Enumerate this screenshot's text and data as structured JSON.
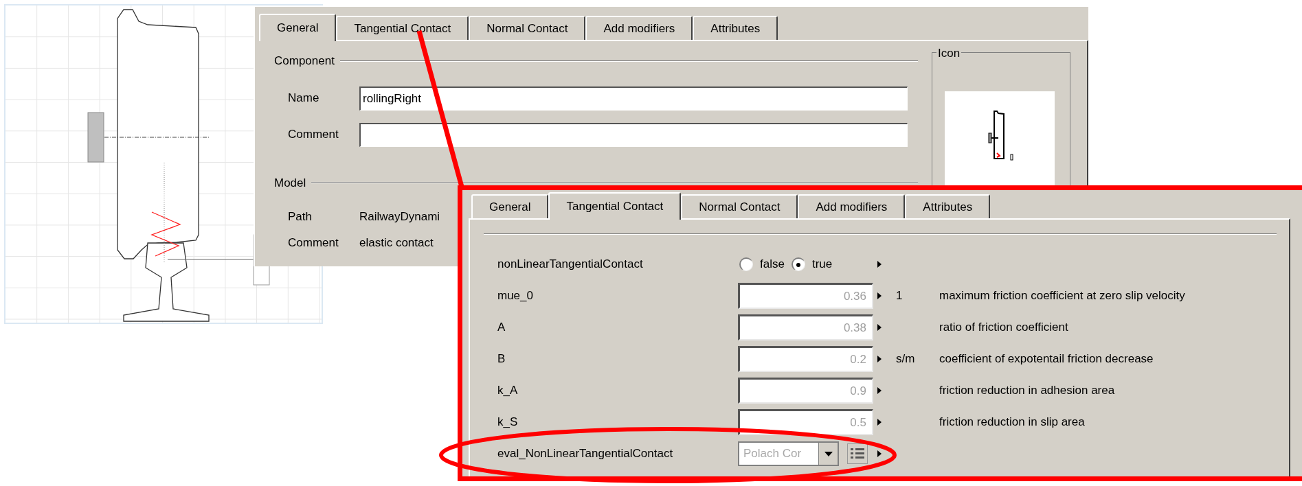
{
  "general_dialog": {
    "tabs": [
      {
        "label": "General",
        "selected": true
      },
      {
        "label": "Tangential Contact",
        "selected": false
      },
      {
        "label": "Normal Contact",
        "selected": false
      },
      {
        "label": "Add modifiers",
        "selected": false
      },
      {
        "label": "Attributes",
        "selected": false
      }
    ],
    "component": {
      "title": "Component",
      "fields": [
        {
          "label": "Name",
          "value": "rollingRight"
        },
        {
          "label": "Comment"
        }
      ]
    },
    "model": {
      "title": "Model",
      "rows": [
        {
          "label": "Path",
          "value": "RailwayDynami"
        },
        {
          "label": "Comment",
          "value": "elastic contact"
        }
      ]
    },
    "icon_group": {
      "title": "Icon"
    }
  },
  "tangential_dialog": {
    "tabs": [
      {
        "label": "General",
        "selected": false
      },
      {
        "label": "Tangential Contact",
        "selected": true
      },
      {
        "label": "Normal Contact",
        "selected": false
      },
      {
        "label": "Add modifiers",
        "selected": false
      },
      {
        "label": "Attributes",
        "selected": false
      }
    ],
    "parameters": [
      {
        "kind": "radio",
        "name": "nonLinearTangentialContact",
        "options": [
          {
            "label": "false",
            "selected": false
          },
          {
            "label": "true",
            "selected": true
          }
        ]
      },
      {
        "kind": "number",
        "name": "mue_0",
        "value": "0.36",
        "unit": "1",
        "description": "maximum friction coefficient at zero slip velocity"
      },
      {
        "kind": "number",
        "name": "A",
        "value": "0.38",
        "description": "ratio of friction coefficient"
      },
      {
        "kind": "number",
        "name": "B",
        "value": "0.2",
        "unit": "s/m",
        "description": "coefficient of expotentail friction decrease"
      },
      {
        "kind": "number",
        "name": "k_A",
        "value": "0.9",
        "description": "friction reduction in adhesion area"
      },
      {
        "kind": "number",
        "name": "k_S",
        "value": "0.5",
        "description": "friction reduction in slip area"
      },
      {
        "kind": "dropdown",
        "name": "eval_NonLinearTangentialContact",
        "value": "Polach Cor"
      }
    ]
  }
}
